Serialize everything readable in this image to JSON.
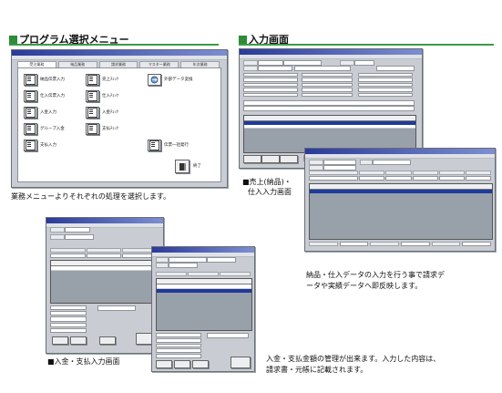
{
  "sections": {
    "menu": {
      "heading": "プログラム選択メニュー",
      "caption": "業務メニューよりそれぞれの処理を選択します。"
    },
    "input": {
      "heading": "入力画面"
    },
    "sales_caption": {
      "line1": "■売上(納品)・",
      "line2": "仕入入力画面"
    },
    "sales_desc": {
      "line1": "納品・仕入データの入力を行う事で請求デ",
      "line2": "ータや実績データへ即反映します。"
    },
    "payment_caption": "■入金・支払入力画面",
    "payment_desc": {
      "line1": "入金・支払金額の管理が出来ます。入力した内容は、",
      "line2": "請求書・元帳に記載されます。"
    }
  },
  "menu_window": {
    "tabs": [
      "受注業務",
      "納品業務",
      "請求業務",
      "マスター業務",
      "年次業務"
    ],
    "buttons": [
      {
        "label": "納品伝票入力",
        "icon": "document-icon"
      },
      {
        "label": "仕入伝票入力",
        "icon": "document-icon"
      },
      {
        "label": "入金入力",
        "icon": "document-icon"
      },
      {
        "label": "グループ入金",
        "icon": "document-icon"
      },
      {
        "label": "支払入力",
        "icon": "document-icon"
      },
      {
        "label": "売上ﾁｪｯｸ",
        "icon": "document-icon"
      },
      {
        "label": "仕入ﾁｪｯｸ",
        "icon": "document-icon"
      },
      {
        "label": "入金ﾁｪｯｸ",
        "icon": "document-icon"
      },
      {
        "label": "支払ﾁｪｯｸ",
        "icon": "document-icon"
      },
      {
        "label": "外部データ変換",
        "icon": "convert-icon"
      },
      {
        "label": "伝票一括発行",
        "icon": "document-icon"
      }
    ],
    "close_label": "終了"
  }
}
